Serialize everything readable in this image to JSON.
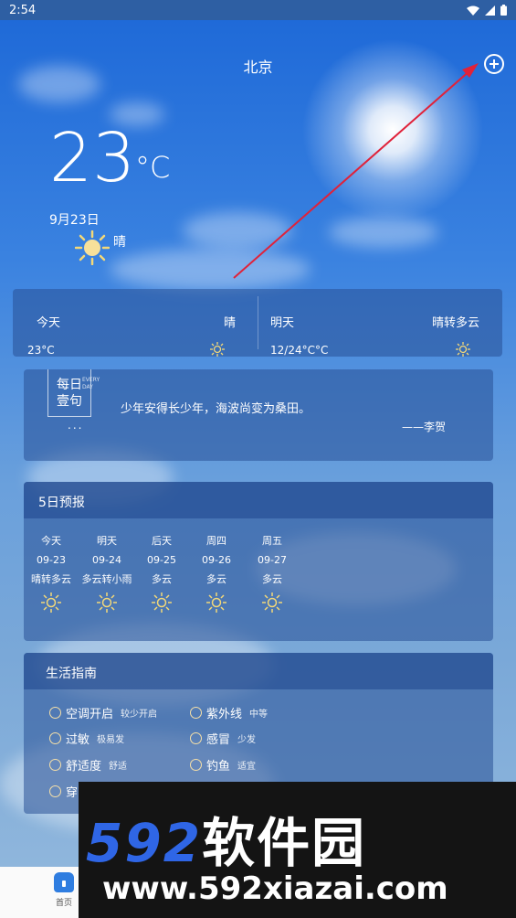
{
  "status_bar": {
    "time": "2:54"
  },
  "city": "北京",
  "current": {
    "temp": "23",
    "unit": "°C",
    "date": "9月23日",
    "condition": "晴"
  },
  "today_card": {
    "today_label": "今天",
    "today_cond": "晴",
    "today_temp": "23°C",
    "tomorrow_label": "明天",
    "tomorrow_cond": "晴转多云",
    "tomorrow_temp": "12/24°C°C"
  },
  "quote": {
    "badge_line1": "每日",
    "badge_line2": "壹句",
    "badge_en1": "EVERY",
    "badge_en2": "DAY",
    "dots": "...",
    "text": "少年安得长少年，海波尚变为桑田。",
    "author": "——李贺"
  },
  "forecast": {
    "title": "5日预报",
    "days": [
      {
        "day": "今天",
        "date": "09-23",
        "cond": "晴转多云"
      },
      {
        "day": "明天",
        "date": "09-24",
        "cond": "多云转小雨"
      },
      {
        "day": "后天",
        "date": "09-25",
        "cond": "多云"
      },
      {
        "day": "周四",
        "date": "09-26",
        "cond": "多云"
      },
      {
        "day": "周五",
        "date": "09-27",
        "cond": "多云"
      }
    ]
  },
  "guide": {
    "title": "生活指南",
    "items": [
      {
        "label": "空调开启",
        "value": "较少开启"
      },
      {
        "label": "紫外线",
        "value": "中等"
      },
      {
        "label": "过敏",
        "value": "极易发"
      },
      {
        "label": "感冒",
        "value": "少发"
      },
      {
        "label": "舒适度",
        "value": "舒适"
      },
      {
        "label": "钓鱼",
        "value": "适宜"
      },
      {
        "label": "穿",
        "value": ""
      }
    ]
  },
  "nav": {
    "home_label": "首页"
  },
  "watermark": {
    "num": "592",
    "cn": "软件园",
    "url": "www.592xiazai.com"
  },
  "colors": {
    "accent": "#2f7de0",
    "arrow": "#e0223a"
  }
}
